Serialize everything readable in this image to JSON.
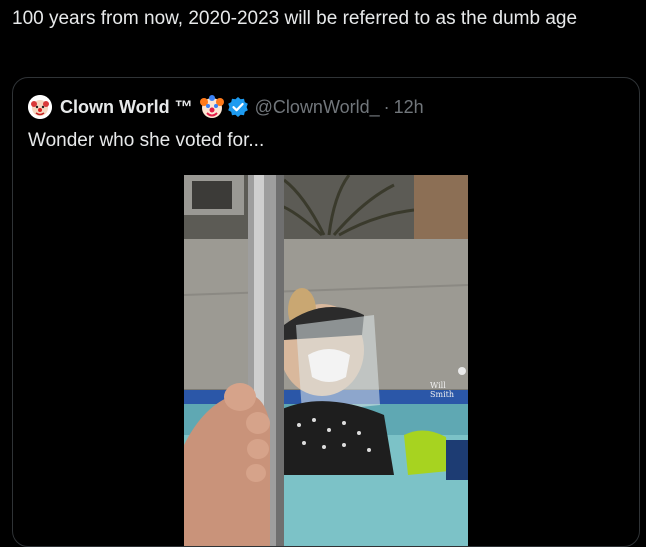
{
  "tweet": {
    "text": "100 years from now, 2020-2023 will be referred to as the dumb age"
  },
  "quoted_tweet": {
    "display_name": "Clown World ™",
    "handle": "@ClownWorld_",
    "separator": "·",
    "time": "12h",
    "text": "Wonder who she voted for...",
    "badge_icon": "verified-badge-icon",
    "emoji_icon": "clown-face-icon",
    "media": {
      "watermark": "Will Smith"
    }
  },
  "colors": {
    "background": "#000000",
    "text": "#e7e9ea",
    "secondary": "#71767b",
    "border": "#2f3336",
    "verified": "#1d9bf0"
  }
}
